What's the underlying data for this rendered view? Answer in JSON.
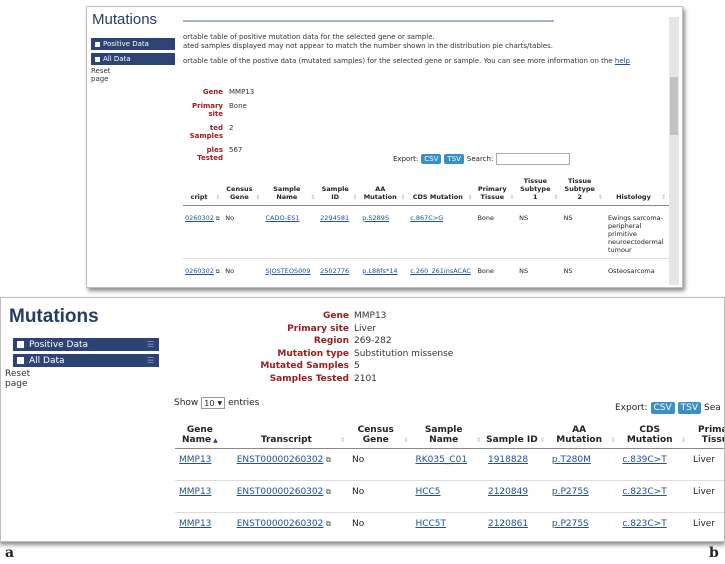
{
  "panel_a": {
    "title": "Mutations",
    "nav": [
      {
        "label": "Positive Data"
      },
      {
        "label": "All Data"
      }
    ],
    "reset": "Reset page",
    "info_lines": [
      "ortable table of positive mutation data for the selected gene or sample.",
      "ated samples displayed may not appear to match the number shown in the distribution pie charts/tables.",
      "ortable table of the postive data (mutated samples) for the selected gene or sample. You can see more information on the "
    ],
    "help_link": "help",
    "fields": [
      {
        "label": "Gene",
        "value": "MMP13"
      },
      {
        "label": "Primary site",
        "value": "Bone"
      },
      {
        "label": "ted Samples",
        "value": "2"
      },
      {
        "label": "ples Tested",
        "value": "567"
      }
    ],
    "export_label": "Export:",
    "csv": "CSV",
    "tsv": "TSV",
    "search_label": "Search:",
    "headers": [
      "cript",
      "Census Gene",
      "Sample Name",
      "Sample ID",
      "AA Mutation",
      "CDS Mutation",
      "Primary Tissue",
      "Tissue Subtype 1",
      "Tissue Subtype 2",
      "Histology"
    ],
    "rows": [
      [
        "0260302",
        "No",
        "CADO-ES1",
        "2294581",
        "p.S289S",
        "c.867C>G",
        "Bone",
        "NS",
        "NS",
        "Ewings sarcoma-peripheral primitive neuroectodermal tumour"
      ],
      [
        "0260302",
        "No",
        "SJOSTEOS009",
        "2502776",
        "p.L88fs*14",
        "c.260_261insACAC",
        "Bone",
        "NS",
        "NS",
        "Osteosarcoma"
      ]
    ]
  },
  "panel_b": {
    "title": "Mutations",
    "nav": [
      {
        "label": "Positive Data"
      },
      {
        "label": "All Data"
      }
    ],
    "reset": "Reset page",
    "fields": [
      {
        "label": "Gene",
        "value": "MMP13"
      },
      {
        "label": "Primary site",
        "value": "Liver"
      },
      {
        "label": "Region",
        "value": "269-282"
      },
      {
        "label": "Mutation type",
        "value": "Substitution missense"
      },
      {
        "label": "Mutated Samples",
        "value": "5"
      },
      {
        "label": "Samples Tested",
        "value": "2101"
      }
    ],
    "show_label": "Show",
    "show_value": "10",
    "entries_label": "entries",
    "export_label": "Export:",
    "csv": "CSV",
    "tsv": "TSV",
    "search_partial": "Sea",
    "headers": [
      "Gene Name",
      "Transcript",
      "Census Gene",
      "Sample Name",
      "Sample ID",
      "AA Mutation",
      "CDS Mutation",
      "Primary Tissue"
    ],
    "rows": [
      [
        "MMP13",
        "ENST00000260302",
        "No",
        "RK035_C01",
        "1918828",
        "p.T280M",
        "c.839C>T",
        "Liver"
      ],
      [
        "MMP13",
        "ENST00000260302",
        "No",
        "HCC5",
        "2120849",
        "p.P275S",
        "c.823C>T",
        "Liver"
      ],
      [
        "MMP13",
        "ENST00000260302",
        "No",
        "HCC5T",
        "2120861",
        "p.P275S",
        "c.823C>T",
        "Liver"
      ]
    ]
  },
  "captions": {
    "a": "a",
    "b": "b"
  },
  "colors": {
    "nav_bg": "#2d4373",
    "field_label": "#9b1d20",
    "link": "#1f4fa3",
    "export_button": "#3a8fc9"
  }
}
